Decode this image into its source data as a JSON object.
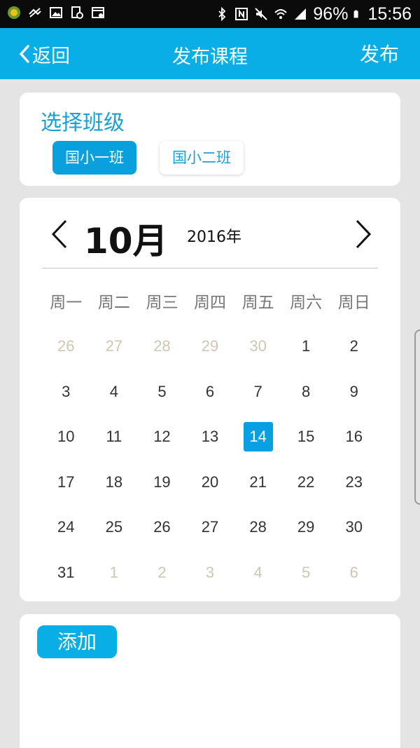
{
  "status_bar": {
    "battery": "96%",
    "time": "15:56",
    "icons": [
      "app-icon",
      "vpn-icon",
      "image-icon",
      "clock-file-icon",
      "calendar-icon",
      "bluetooth-icon",
      "nfc-icon",
      "mute-icon",
      "wifi-icon",
      "signal-icon",
      "battery-icon"
    ]
  },
  "app_bar": {
    "back_label": "返回",
    "title": "发布课程",
    "publish_label": "发布"
  },
  "class_select": {
    "heading": "选择班级",
    "classes": [
      {
        "label": "国小一班",
        "selected": true
      },
      {
        "label": "国小二班",
        "selected": false
      }
    ]
  },
  "calendar": {
    "month": "10月",
    "year": "2016年",
    "weekdays": [
      "周一",
      "周二",
      "周三",
      "周四",
      "周五",
      "周六",
      "周日"
    ],
    "weeks": [
      [
        "26",
        "27",
        "28",
        "29",
        "30",
        "1",
        "2"
      ],
      [
        "3",
        "4",
        "5",
        "6",
        "7",
        "8",
        "9"
      ],
      [
        "10",
        "11",
        "12",
        "13",
        "14",
        "15",
        "16"
      ],
      [
        "17",
        "18",
        "19",
        "20",
        "21",
        "22",
        "23"
      ],
      [
        "24",
        "25",
        "26",
        "27",
        "28",
        "29",
        "30"
      ],
      [
        "31",
        "1",
        "2",
        "3",
        "4",
        "5",
        "6"
      ]
    ],
    "selected_day": "14",
    "colors": {
      "accent": "#0a9fe0",
      "other_month": "#cfc6b4"
    }
  },
  "add_section": {
    "add_label": "添加"
  },
  "theme": {
    "primary": "#0aaee6",
    "heading_blue": "#1a9fd6",
    "background": "#e4e4e4"
  }
}
